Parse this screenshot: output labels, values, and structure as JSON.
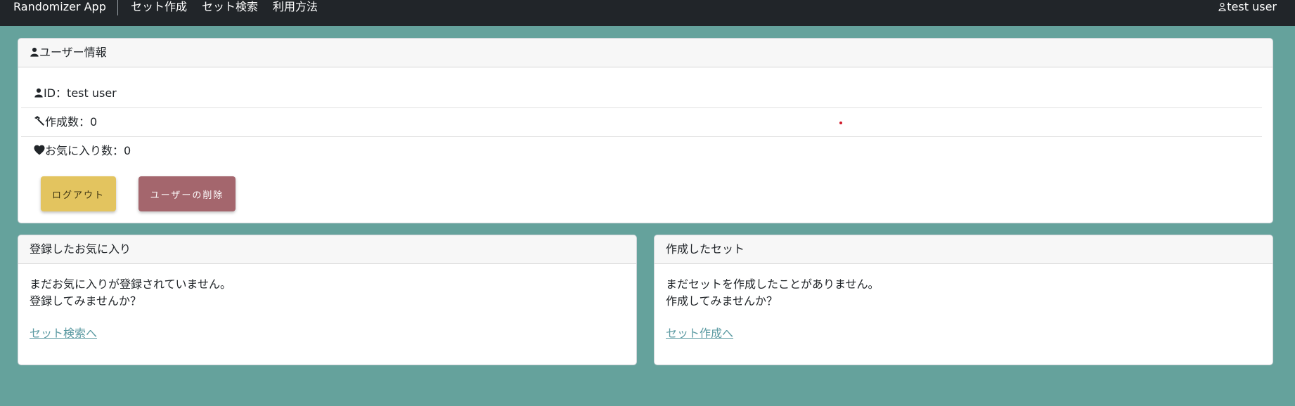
{
  "navbar": {
    "brand": "Randomizer App",
    "links": [
      "セット作成",
      "セット検索",
      "利用方法"
    ],
    "user": "test user",
    "user_icon": "person-outline-icon"
  },
  "user_info": {
    "header": "ユーザー情報",
    "header_icon": "person-icon",
    "rows": [
      {
        "icon": "person-icon",
        "text": "ID：test user"
      },
      {
        "icon": "hammer-icon",
        "text": "作成数：0"
      },
      {
        "icon": "heart-icon",
        "text": "お気に入り数：0"
      }
    ],
    "logout_label": "ログアウト",
    "delete_label": "ユーザーの削除"
  },
  "favorites": {
    "header": "登録したお気に入り",
    "line1": "まだお気に入りが登録されていません。",
    "line2": "登録してみませんか？",
    "link": "セット検索へ"
  },
  "created_sets": {
    "header": "作成したセット",
    "line1": "まだセットを作成したことがありません。",
    "line2": "作成してみませんか？",
    "link": "セット作成へ"
  },
  "colors": {
    "background": "#65a29c",
    "navbar": "#212529",
    "logout_button": "#e3c45f",
    "delete_button": "#a4666d",
    "link": "#5b9aa2"
  }
}
